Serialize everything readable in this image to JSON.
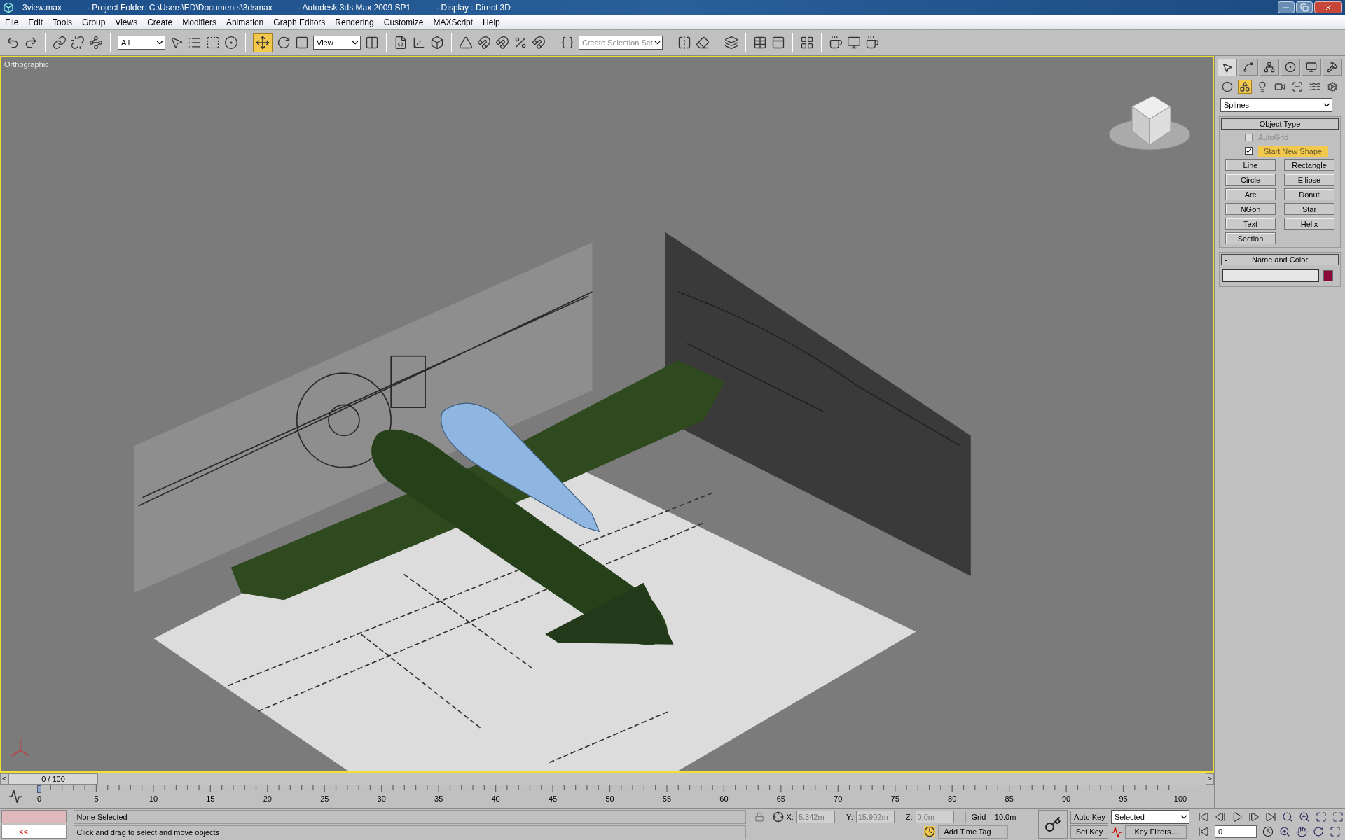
{
  "window": {
    "title_parts": [
      "3view.max",
      "- Project Folder: C:\\Users\\ED\\Documents\\3dsmax",
      "- Autodesk 3ds Max  2009 SP1",
      "- Display : Direct 3D"
    ]
  },
  "menu": [
    "File",
    "Edit",
    "Tools",
    "Group",
    "Views",
    "Create",
    "Modifiers",
    "Animation",
    "Graph Editors",
    "Rendering",
    "Customize",
    "MAXScript",
    "Help"
  ],
  "toolbar": {
    "selection_filter": "All",
    "reference_coord": "View",
    "selection_set": {
      "placeholder": "Create Selection Set"
    },
    "move_tool": {
      "selected": true
    }
  },
  "viewport": {
    "label": "Orthographic",
    "active": true
  },
  "command_panel": {
    "tabs": [
      {
        "selected": true
      },
      {
        "selected": false
      },
      {
        "selected": false
      },
      {
        "selected": false
      },
      {
        "selected": false
      },
      {
        "selected": false
      }
    ],
    "categories": [
      {
        "selected": false
      },
      {
        "selected": true
      },
      {
        "selected": false
      },
      {
        "selected": false
      },
      {
        "selected": false
      },
      {
        "selected": false
      },
      {
        "selected": false
      }
    ],
    "dropdown": "Splines",
    "object_type": {
      "sign": "-",
      "title": "Object Type",
      "autogrid": {
        "label": "AutoGrid",
        "checked": false,
        "disabled": true
      },
      "start_new_shape": {
        "label": "Start New Shape",
        "checked": true
      },
      "buttons": [
        "Line",
        "Rectangle",
        "Circle",
        "Ellipse",
        "Arc",
        "Donut",
        "NGon",
        "Star",
        "Text",
        "Helix",
        "Section"
      ]
    },
    "name_and_color": {
      "sign": "-",
      "title": "Name and Color",
      "color": "#8b0a3a"
    }
  },
  "timeline": {
    "frame": "0 / 100",
    "prev": "<",
    "next": ">",
    "ticks": [
      "0",
      "5",
      "10",
      "15",
      "20",
      "25",
      "30",
      "35",
      "40",
      "45",
      "50",
      "55",
      "60",
      "65",
      "70",
      "75",
      "80",
      "85",
      "90",
      "95",
      "100"
    ]
  },
  "status": {
    "selection": "None Selected",
    "prompt": "Click and drag to select and move objects",
    "maxscript": "<<",
    "x_label": "X:",
    "x": "5.342m",
    "y_label": "Y:",
    "y": "15.902m",
    "z_label": "Z:",
    "z": "0.0m",
    "grid": "Grid = 10.0m",
    "add_time_tag": "Add Time Tag",
    "auto_key": "Auto Key",
    "set_key": "Set Key",
    "key_mode": "Selected",
    "key_filters": "Key Filters...",
    "frame": "0"
  }
}
